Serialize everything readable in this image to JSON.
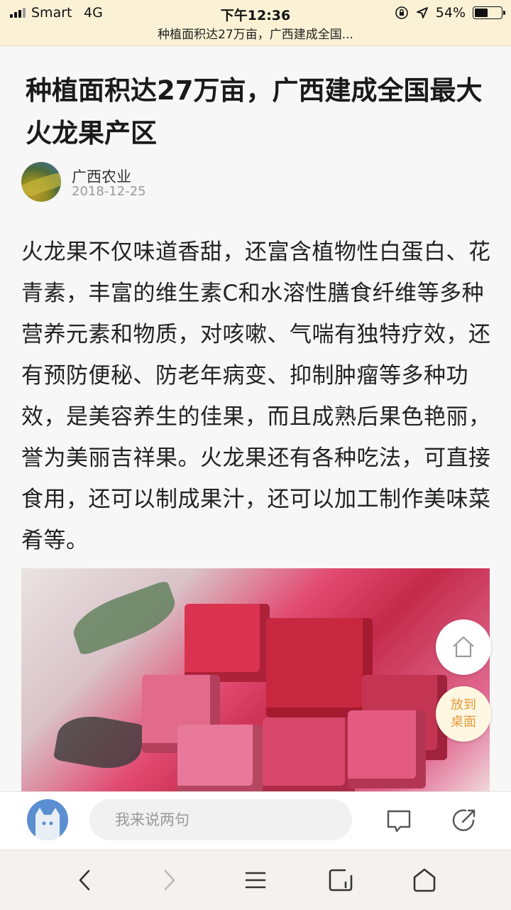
{
  "status_bar": {
    "carrier": "Smart",
    "network": "4G",
    "time": "下午12:36",
    "battery_percent": "54%",
    "battery_level": 0.54,
    "page_title": "种植面积达27万亩，广西建成全国..."
  },
  "article": {
    "title": "种植面积达27万亩，广西建成全国最大火龙果产区",
    "author": "广西农业",
    "date": "2018-12-25",
    "body": "火龙果不仅味道香甜，还富含植物性白蛋白、花青素，丰富的维生素C和水溶性膳食纤维等多种营养元素和物质，对咳嗽、气喘有独特疗效，还有预防便秘、防老年病变、抑制肿瘤等多种功效，是美容养生的佳果，而且成熟后果色艳丽，誉为美丽吉祥果。火龙果还有各种吃法，可直接食用，还可以制成果汁，还可以加工制作美味菜肴等。"
  },
  "floating": {
    "home_icon": "home-icon",
    "desktop_label": "放到桌面"
  },
  "comment_bar": {
    "placeholder": "我来说两句",
    "comment_icon": "comment-icon",
    "share_icon": "share-icon"
  },
  "browser_nav": {
    "icons": [
      "back-icon",
      "forward-icon",
      "menu-icon",
      "tabs-icon",
      "home-icon"
    ]
  },
  "colors": {
    "status_bar_bg": "#fbf2d6",
    "desktop_button_text": "#e59a3a",
    "user_avatar": "#5b8fd2"
  }
}
